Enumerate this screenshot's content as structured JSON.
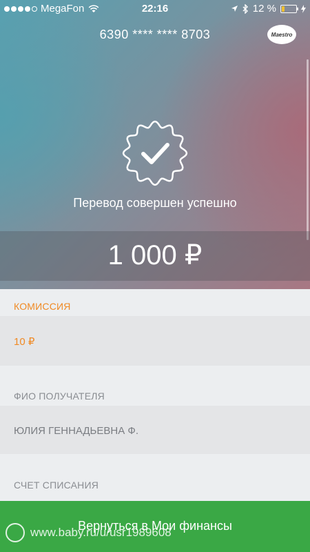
{
  "status_bar": {
    "carrier": "MegaFon",
    "time": "22:16",
    "battery": "12 %",
    "signal_bars_filled": 4,
    "signal_bars_total": 5
  },
  "card": {
    "number": "6390 **** **** 8703",
    "brand": "Maestro"
  },
  "result": {
    "message": "Перевод совершен успешно",
    "amount": "1 000 ₽"
  },
  "details": {
    "commission_label": "КОМИССИЯ",
    "commission_value": "10 ₽",
    "recipient_label": "ФИО ПОЛУЧАТЕЛЯ",
    "recipient_value": "ЮЛИЯ ГЕННАДЬЕВНА Ф.",
    "debit_account_label": "СЧЕТ СПИСАНИЯ"
  },
  "actions": {
    "return_button": "Вернуться в Мои финансы"
  },
  "watermark": {
    "text": "www.baby.ru/u/usr1989608"
  },
  "colors": {
    "accent_orange": "#f08a24",
    "success_green": "#3aa845",
    "label_gray": "#8a8d92",
    "value_gray": "#7a7d82"
  }
}
